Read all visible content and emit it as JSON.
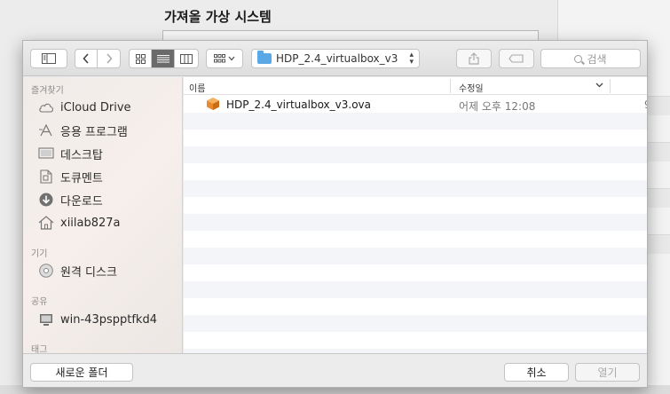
{
  "background": {
    "title": "가져올 가상 시스템"
  },
  "toolbar": {
    "path_label": "HDP_2.4_virtualbox_v3",
    "search_placeholder": "검색"
  },
  "sidebar": {
    "sections": [
      {
        "header": "즐겨찾기",
        "items": [
          {
            "label": "iCloud Drive",
            "icon": "cloud-icon"
          },
          {
            "label": "응용 프로그램",
            "icon": "applications-icon"
          },
          {
            "label": "데스크탑",
            "icon": "desktop-icon"
          },
          {
            "label": "도큐멘트",
            "icon": "document-icon"
          },
          {
            "label": "다운로드",
            "icon": "download-icon"
          },
          {
            "label": "xiilab827a",
            "icon": "home-icon"
          }
        ]
      },
      {
        "header": "기기",
        "items": [
          {
            "label": "원격 디스크",
            "icon": "disc-icon"
          }
        ]
      },
      {
        "header": "공유",
        "items": [
          {
            "label": "win-43pspptfkd4",
            "icon": "computer-icon"
          }
        ]
      },
      {
        "header": "태그",
        "items": []
      }
    ]
  },
  "filelist": {
    "columns": [
      "이름",
      "수정일"
    ],
    "files": [
      {
        "name": "HDP_2.4_virtualbox_v3.ova",
        "modified": "어제 오후 12:08",
        "size": "9"
      }
    ]
  },
  "footer": {
    "new_folder": "새로운 폴더",
    "cancel": "취소",
    "open": "열기"
  },
  "colors": {
    "folder": "#5aa8e6",
    "ova": "#e8892b",
    "pressed": "#6b6b6b"
  }
}
